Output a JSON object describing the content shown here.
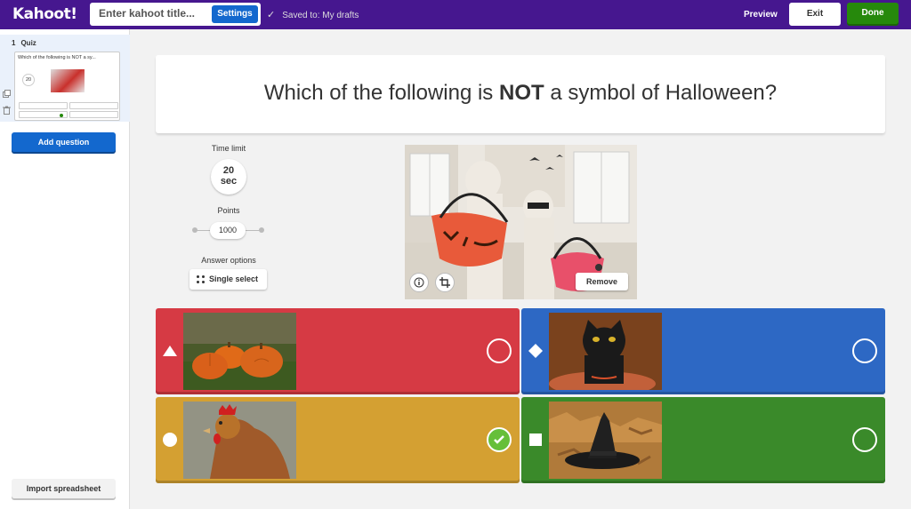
{
  "topbar": {
    "logo": "Kahoot!",
    "title_placeholder": "Enter kahoot title...",
    "settings_label": "Settings",
    "saved_status": "Saved to: My drafts",
    "preview_label": "Preview",
    "exit_label": "Exit",
    "done_label": "Done",
    "brand_color": "#46178f"
  },
  "sidebar": {
    "slide_number": "1",
    "slide_type": "Quiz",
    "thumb_title": "Which of the following is NOT a sy...",
    "thumb_time": "20",
    "add_question_label": "Add question",
    "import_label": "Import spreadsheet"
  },
  "question": {
    "text_before": "Which of the following is ",
    "text_bold": "NOT",
    "text_after": " a symbol of Halloween?"
  },
  "settings": {
    "time_label": "Time limit",
    "time_value": "20",
    "time_unit": "sec",
    "points_label": "Points",
    "points_value": "1000",
    "answer_options_label": "Answer options",
    "answer_options_value": "Single select"
  },
  "media": {
    "remove_label": "Remove",
    "info_icon": "info-icon",
    "crop_icon": "crop-icon"
  },
  "answers": [
    {
      "shape": "triangle",
      "color": "#d63a44",
      "image": "pumpkins",
      "correct": false
    },
    {
      "shape": "diamond",
      "color": "#2d68c4",
      "image": "black-cat",
      "correct": false
    },
    {
      "shape": "circle",
      "color": "#d4a032",
      "image": "chicken",
      "correct": true
    },
    {
      "shape": "square",
      "color": "#3a8a2a",
      "image": "witch-hat",
      "correct": false
    }
  ]
}
